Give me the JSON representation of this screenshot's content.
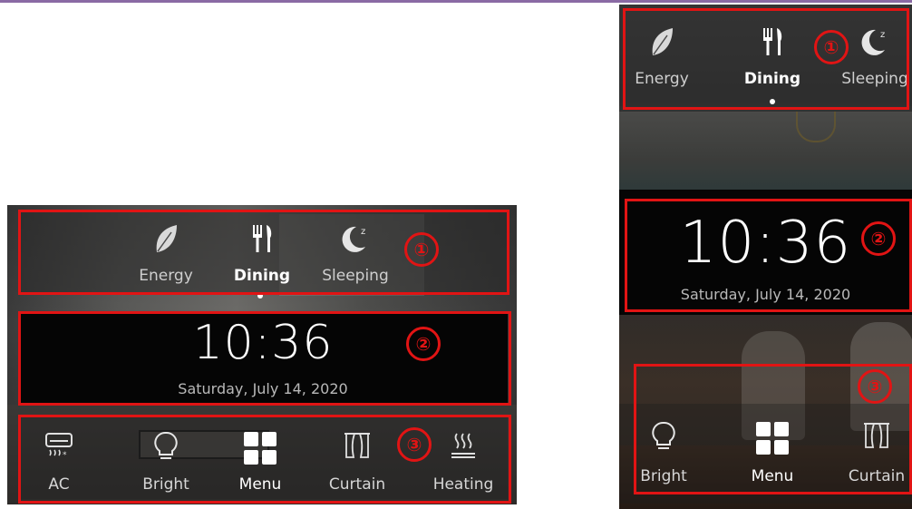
{
  "colors": {
    "annotation": "#e11414",
    "accent_line": "#8a6aa4"
  },
  "landscape": {
    "scenes": [
      {
        "label": "Energy",
        "icon": "leaf-icon"
      },
      {
        "label": "Dining",
        "icon": "fork-knife-icon",
        "active": true
      },
      {
        "label": "Sleeping",
        "icon": "moon-zzz-icon"
      }
    ],
    "time": "10:36",
    "date": "Saturday, July 14, 2020",
    "controls": [
      {
        "label": "AC",
        "icon": "air-conditioner-icon"
      },
      {
        "label": "Bright",
        "icon": "light-bulb-icon"
      },
      {
        "label": "Menu",
        "icon": "grid-menu-icon",
        "active": true
      },
      {
        "label": "Curtain",
        "icon": "curtain-icon"
      },
      {
        "label": "Heating",
        "icon": "heating-icon"
      }
    ]
  },
  "portrait": {
    "scenes": [
      {
        "label": "Energy",
        "icon": "leaf-icon"
      },
      {
        "label": "Dining",
        "icon": "fork-knife-icon",
        "active": true
      },
      {
        "label": "Sleeping",
        "icon": "moon-zzz-icon"
      }
    ],
    "time": "10:36",
    "date": "Saturday, July 14, 2020",
    "controls": [
      {
        "label": "Bright",
        "icon": "light-bulb-icon"
      },
      {
        "label": "Menu",
        "icon": "grid-menu-icon",
        "active": true
      },
      {
        "label": "Curtain",
        "icon": "curtain-icon"
      }
    ]
  },
  "annotations": {
    "one": "①",
    "two": "②",
    "three": "③"
  }
}
